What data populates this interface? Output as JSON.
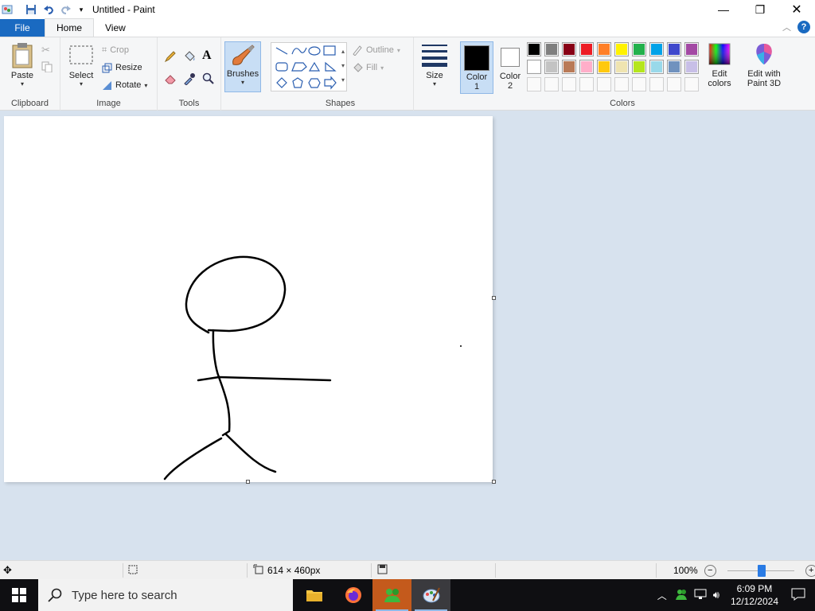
{
  "titlebar": {
    "title": "Untitled - Paint",
    "quick_access": [
      "save-icon",
      "undo-icon",
      "redo-icon",
      "customize-dropdown-icon"
    ],
    "window_buttons": [
      "minimize",
      "maximize",
      "close"
    ]
  },
  "tabs": {
    "file": "File",
    "home": "Home",
    "view": "View"
  },
  "ribbon": {
    "clipboard": {
      "label": "Clipboard",
      "paste": "Paste"
    },
    "image": {
      "label": "Image",
      "select": "Select",
      "crop": "Crop",
      "resize": "Resize",
      "rotate": "Rotate"
    },
    "tools": {
      "label": "Tools"
    },
    "brushes": {
      "label": "Brushes"
    },
    "shapes": {
      "label": "Shapes",
      "outline": "Outline",
      "fill": "Fill"
    },
    "size": {
      "label": "Size"
    },
    "color1": {
      "label": "Color",
      "num": "1",
      "value": "#000000"
    },
    "color2": {
      "label": "Color",
      "num": "2",
      "value": "#ffffff"
    },
    "colors": {
      "label": "Colors",
      "row1": [
        "#000000",
        "#7f7f7f",
        "#880015",
        "#ed1c24",
        "#ff7f27",
        "#fff200",
        "#22b14c",
        "#00a2e8",
        "#3f48cc",
        "#a349a4"
      ],
      "row2": [
        "#ffffff",
        "#c3c3c3",
        "#b97a57",
        "#ffaec9",
        "#ffc90e",
        "#efe4b0",
        "#b5e61d",
        "#99d9ea",
        "#7092be",
        "#c8bfe7"
      ]
    },
    "edit_colors": {
      "line1": "Edit",
      "line2": "colors"
    },
    "paint3d": {
      "line1": "Edit with",
      "line2": "Paint 3D"
    }
  },
  "statusbar": {
    "dimensions": "614 × 460px",
    "zoom": "100%"
  },
  "taskbar": {
    "search_placeholder": "Type here to search",
    "apps": [
      "file-explorer",
      "firefox",
      "app-green",
      "paint"
    ],
    "time": "6:09 PM",
    "date": "12/12/2024"
  }
}
